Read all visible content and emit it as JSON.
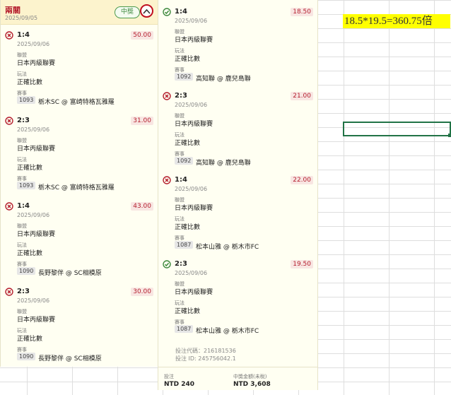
{
  "colors": {
    "accent_red": "#b51f2e",
    "win_green": "#3f8a3f",
    "panel_bg": "#fffff2",
    "header_bg": "#fcf3cd",
    "note_highlight": "#ffff00"
  },
  "sheet": {
    "note": "18.5*19.5=360.75倍"
  },
  "left_panel": {
    "header": {
      "title": "兩關",
      "date": "2025/09/05",
      "badge": "中獎",
      "collapse_icon": "chevron-up-icon"
    },
    "bets": [
      {
        "status": "lose",
        "score": "1:4",
        "date": "2025/09/06",
        "odds": "50.00",
        "league_label": "聯盟",
        "league": "日本丙級聯賽",
        "play_label": "玩法",
        "play": "正確比數",
        "match_label": "賽事",
        "match_id": "1093",
        "match": "栃木SC @ 富崎特格瓦雅羅"
      },
      {
        "status": "lose",
        "score": "2:3",
        "date": "2025/09/06",
        "odds": "31.00",
        "league_label": "聯盟",
        "league": "日本丙級聯賽",
        "play_label": "玩法",
        "play": "正確比數",
        "match_label": "賽事",
        "match_id": "1093",
        "match": "栃木SC @ 富崎特格瓦雅羅"
      },
      {
        "status": "lose",
        "score": "1:4",
        "date": "2025/09/06",
        "odds": "43.00",
        "league_label": "聯盟",
        "league": "日本丙級聯賽",
        "play_label": "玩法",
        "play": "正確比數",
        "match_label": "賽事",
        "match_id": "1090",
        "match": "長野黎伴 @ SC相模原"
      },
      {
        "status": "lose",
        "score": "2:3",
        "date": "2025/09/06",
        "odds": "30.00",
        "league_label": "聯盟",
        "league": "日本丙級聯賽",
        "play_label": "玩法",
        "play": "正確比數",
        "match_label": "賽事",
        "match_id": "1090",
        "match": "長野黎伴 @ SC相模原"
      }
    ]
  },
  "right_panel": {
    "bets": [
      {
        "status": "win",
        "score": "1:4",
        "date": "2025/09/06",
        "odds": "18.50",
        "league_label": "聯盟",
        "league": "日本丙級聯賽",
        "play_label": "玩法",
        "play": "正確比數",
        "match_label": "賽事",
        "match_id": "1092",
        "match": "高知聯 @ 鹿兒島聯"
      },
      {
        "status": "lose",
        "score": "2:3",
        "date": "2025/09/06",
        "odds": "21.00",
        "league_label": "聯盟",
        "league": "日本丙級聯賽",
        "play_label": "玩法",
        "play": "正確比數",
        "match_label": "賽事",
        "match_id": "1092",
        "match": "高知聯 @ 鹿兒島聯"
      },
      {
        "status": "lose",
        "score": "1:4",
        "date": "2025/09/06",
        "odds": "22.00",
        "league_label": "聯盟",
        "league": "日本丙級聯賽",
        "play_label": "玩法",
        "play": "正確比數",
        "match_label": "賽事",
        "match_id": "1087",
        "match": "松本山雅 @ 栃木市FC"
      },
      {
        "status": "win",
        "score": "2:3",
        "date": "2025/09/06",
        "odds": "19.50",
        "league_label": "聯盟",
        "league": "日本丙級聯賽",
        "play_label": "玩法",
        "play": "正確比數",
        "match_label": "賽事",
        "match_id": "1087",
        "match": "松本山雅 @ 栃木市FC"
      }
    ],
    "meta": {
      "code": "投注代碼：216181536",
      "bet_id": "投注 ID: 245756042.1"
    },
    "footer": {
      "stake_label": "投注",
      "stake": "NTD 240",
      "payout_label": "中獎金額(未稅)",
      "payout": "NTD 3,608"
    }
  }
}
